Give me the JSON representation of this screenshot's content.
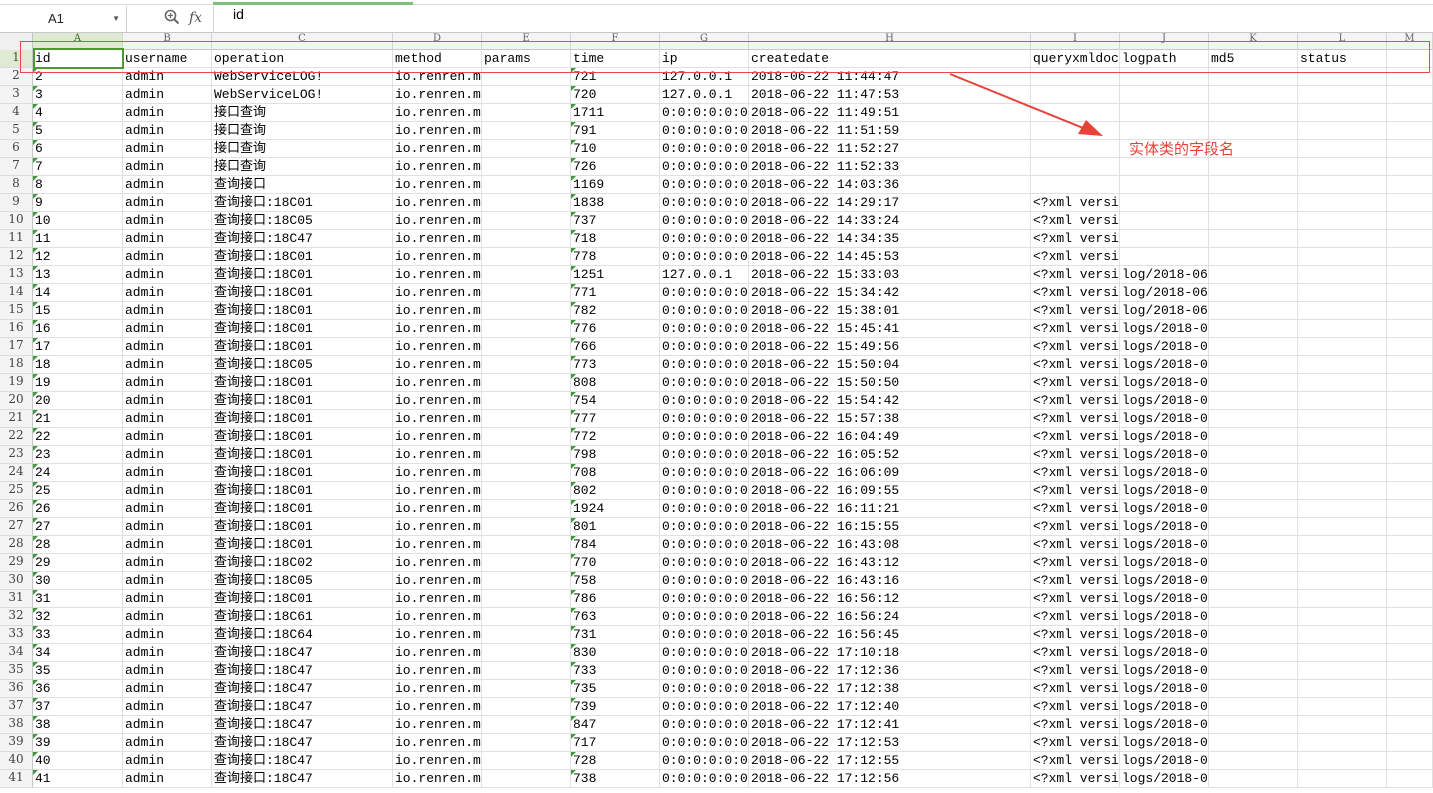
{
  "formula_bar": {
    "name_box": "A1",
    "fx_label": "fx",
    "formula": "id"
  },
  "columns": [
    {
      "letter": "A"
    },
    {
      "letter": "B"
    },
    {
      "letter": "C"
    },
    {
      "letter": "D"
    },
    {
      "letter": "E"
    },
    {
      "letter": "F"
    },
    {
      "letter": "G"
    },
    {
      "letter": "H"
    },
    {
      "letter": "I"
    },
    {
      "letter": "J"
    },
    {
      "letter": "K"
    },
    {
      "letter": "L"
    },
    {
      "letter": "M"
    }
  ],
  "header_row": [
    "id",
    "username",
    "operation",
    "method",
    "params",
    "time",
    "ip",
    "createdate",
    "queryxmldoc",
    "logpath",
    "md5",
    "status"
  ],
  "rows": [
    [
      "2",
      "admin",
      "WebServiceLOG!",
      "io.renren.m",
      "",
      "721",
      "127.0.0.1",
      "2018-06-22 11:44:47",
      "",
      "",
      "",
      ""
    ],
    [
      "3",
      "admin",
      "WebServiceLOG!",
      "io.renren.m",
      "",
      "720",
      "127.0.0.1",
      "2018-06-22 11:47:53",
      "",
      "",
      "",
      ""
    ],
    [
      "4",
      "admin",
      "接口查询",
      "io.renren.m",
      "",
      "1711",
      "0:0:0:0:0:0",
      "2018-06-22 11:49:51",
      "",
      "",
      "",
      ""
    ],
    [
      "5",
      "admin",
      "接口查询",
      "io.renren.m",
      "",
      "791",
      "0:0:0:0:0:0",
      "2018-06-22 11:51:59",
      "",
      "",
      "",
      ""
    ],
    [
      "6",
      "admin",
      "接口查询",
      "io.renren.m",
      "",
      "710",
      "0:0:0:0:0:0",
      "2018-06-22 11:52:27",
      "",
      "",
      "",
      ""
    ],
    [
      "7",
      "admin",
      "接口查询",
      "io.renren.m",
      "",
      "726",
      "0:0:0:0:0:0",
      "2018-06-22 11:52:33",
      "",
      "",
      "",
      ""
    ],
    [
      "8",
      "admin",
      "查询接口",
      "io.renren.m",
      "",
      "1169",
      "0:0:0:0:0:0",
      "2018-06-22 14:03:36",
      "",
      "",
      "",
      ""
    ],
    [
      "9",
      "admin",
      "查询接口:18C01",
      "io.renren.m",
      "",
      "1838",
      "0:0:0:0:0:0",
      "2018-06-22 14:29:17",
      "<?xml versi",
      "",
      "",
      ""
    ],
    [
      "10",
      "admin",
      "查询接口:18C05",
      "io.renren.m",
      "",
      "737",
      "0:0:0:0:0:0",
      "2018-06-22 14:33:24",
      "<?xml versi",
      "",
      "",
      ""
    ],
    [
      "11",
      "admin",
      "查询接口:18C47",
      "io.renren.m",
      "",
      "718",
      "0:0:0:0:0:0",
      "2018-06-22 14:34:35",
      "<?xml versi",
      "",
      "",
      ""
    ],
    [
      "12",
      "admin",
      "查询接口:18C01",
      "io.renren.m",
      "",
      "778",
      "0:0:0:0:0:0",
      "2018-06-22 14:45:53",
      "<?xml versi",
      "",
      "",
      ""
    ],
    [
      "13",
      "admin",
      "查询接口:18C01",
      "io.renren.m",
      "",
      "1251",
      "127.0.0.1",
      "2018-06-22 15:33:03",
      "<?xml versi",
      "log/2018-06",
      "",
      ""
    ],
    [
      "14",
      "admin",
      "查询接口:18C01",
      "io.renren.m",
      "",
      "771",
      "0:0:0:0:0:0",
      "2018-06-22 15:34:42",
      "<?xml versi",
      "log/2018-06",
      "",
      ""
    ],
    [
      "15",
      "admin",
      "查询接口:18C01",
      "io.renren.m",
      "",
      "782",
      "0:0:0:0:0:0",
      "2018-06-22 15:38:01",
      "<?xml versi",
      "log/2018-06",
      "",
      ""
    ],
    [
      "16",
      "admin",
      "查询接口:18C01",
      "io.renren.m",
      "",
      "776",
      "0:0:0:0:0:0",
      "2018-06-22 15:45:41",
      "<?xml versi",
      "logs/2018-0",
      "",
      ""
    ],
    [
      "17",
      "admin",
      "查询接口:18C01",
      "io.renren.m",
      "",
      "766",
      "0:0:0:0:0:0",
      "2018-06-22 15:49:56",
      "<?xml versi",
      "logs/2018-0",
      "",
      ""
    ],
    [
      "18",
      "admin",
      "查询接口:18C05",
      "io.renren.m",
      "",
      "773",
      "0:0:0:0:0:0",
      "2018-06-22 15:50:04",
      "<?xml versi",
      "logs/2018-0",
      "",
      ""
    ],
    [
      "19",
      "admin",
      "查询接口:18C01",
      "io.renren.m",
      "",
      "808",
      "0:0:0:0:0:0",
      "2018-06-22 15:50:50",
      "<?xml versi",
      "logs/2018-0",
      "",
      ""
    ],
    [
      "20",
      "admin",
      "查询接口:18C01",
      "io.renren.m",
      "",
      "754",
      "0:0:0:0:0:0",
      "2018-06-22 15:54:42",
      "<?xml versi",
      "logs/2018-0",
      "",
      ""
    ],
    [
      "21",
      "admin",
      "查询接口:18C01",
      "io.renren.m",
      "",
      "777",
      "0:0:0:0:0:0",
      "2018-06-22 15:57:38",
      "<?xml versi",
      "logs/2018-0",
      "",
      ""
    ],
    [
      "22",
      "admin",
      "查询接口:18C01",
      "io.renren.m",
      "",
      "772",
      "0:0:0:0:0:0",
      "2018-06-22 16:04:49",
      "<?xml versi",
      "logs/2018-0",
      "",
      ""
    ],
    [
      "23",
      "admin",
      "查询接口:18C01",
      "io.renren.m",
      "",
      "798",
      "0:0:0:0:0:0",
      "2018-06-22 16:05:52",
      "<?xml versi",
      "logs/2018-0",
      "",
      ""
    ],
    [
      "24",
      "admin",
      "查询接口:18C01",
      "io.renren.m",
      "",
      "708",
      "0:0:0:0:0:0",
      "2018-06-22 16:06:09",
      "<?xml versi",
      "logs/2018-0",
      "",
      ""
    ],
    [
      "25",
      "admin",
      "查询接口:18C01",
      "io.renren.m",
      "",
      "802",
      "0:0:0:0:0:0",
      "2018-06-22 16:09:55",
      "<?xml versi",
      "logs/2018-0",
      "",
      ""
    ],
    [
      "26",
      "admin",
      "查询接口:18C01",
      "io.renren.m",
      "",
      "1924",
      "0:0:0:0:0:0",
      "2018-06-22 16:11:21",
      "<?xml versi",
      "logs/2018-0",
      "",
      ""
    ],
    [
      "27",
      "admin",
      "查询接口:18C01",
      "io.renren.m",
      "",
      "801",
      "0:0:0:0:0:0",
      "2018-06-22 16:15:55",
      "<?xml versi",
      "logs/2018-0",
      "",
      ""
    ],
    [
      "28",
      "admin",
      "查询接口:18C01",
      "io.renren.m",
      "",
      "784",
      "0:0:0:0:0:0",
      "2018-06-22 16:43:08",
      "<?xml versi",
      "logs/2018-0",
      "",
      ""
    ],
    [
      "29",
      "admin",
      "查询接口:18C02",
      "io.renren.m",
      "",
      "770",
      "0:0:0:0:0:0",
      "2018-06-22 16:43:12",
      "<?xml versi",
      "logs/2018-0",
      "",
      ""
    ],
    [
      "30",
      "admin",
      "查询接口:18C05",
      "io.renren.m",
      "",
      "758",
      "0:0:0:0:0:0",
      "2018-06-22 16:43:16",
      "<?xml versi",
      "logs/2018-0",
      "",
      ""
    ],
    [
      "31",
      "admin",
      "查询接口:18C01",
      "io.renren.m",
      "",
      "786",
      "0:0:0:0:0:0",
      "2018-06-22 16:56:12",
      "<?xml versi",
      "logs/2018-0",
      "",
      ""
    ],
    [
      "32",
      "admin",
      "查询接口:18C61",
      "io.renren.m",
      "",
      "763",
      "0:0:0:0:0:0",
      "2018-06-22 16:56:24",
      "<?xml versi",
      "logs/2018-0",
      "",
      ""
    ],
    [
      "33",
      "admin",
      "查询接口:18C64",
      "io.renren.m",
      "",
      "731",
      "0:0:0:0:0:0",
      "2018-06-22 16:56:45",
      "<?xml versi",
      "logs/2018-0",
      "",
      ""
    ],
    [
      "34",
      "admin",
      "查询接口:18C47",
      "io.renren.m",
      "",
      "830",
      "0:0:0:0:0:0",
      "2018-06-22 17:10:18",
      "<?xml versi",
      "logs/2018-0",
      "",
      ""
    ],
    [
      "35",
      "admin",
      "查询接口:18C47",
      "io.renren.m",
      "",
      "733",
      "0:0:0:0:0:0",
      "2018-06-22 17:12:36",
      "<?xml versi",
      "logs/2018-0",
      "",
      ""
    ],
    [
      "36",
      "admin",
      "查询接口:18C47",
      "io.renren.m",
      "",
      "735",
      "0:0:0:0:0:0",
      "2018-06-22 17:12:38",
      "<?xml versi",
      "logs/2018-0",
      "",
      ""
    ],
    [
      "37",
      "admin",
      "查询接口:18C47",
      "io.renren.m",
      "",
      "739",
      "0:0:0:0:0:0",
      "2018-06-22 17:12:40",
      "<?xml versi",
      "logs/2018-0",
      "",
      ""
    ],
    [
      "38",
      "admin",
      "查询接口:18C47",
      "io.renren.m",
      "",
      "847",
      "0:0:0:0:0:0",
      "2018-06-22 17:12:41",
      "<?xml versi",
      "logs/2018-0",
      "",
      ""
    ],
    [
      "39",
      "admin",
      "查询接口:18C47",
      "io.renren.m",
      "",
      "717",
      "0:0:0:0:0:0",
      "2018-06-22 17:12:53",
      "<?xml versi",
      "logs/2018-0",
      "",
      ""
    ],
    [
      "40",
      "admin",
      "查询接口:18C47",
      "io.renren.m",
      "",
      "728",
      "0:0:0:0:0:0",
      "2018-06-22 17:12:55",
      "<?xml versi",
      "logs/2018-0",
      "",
      ""
    ],
    [
      "41",
      "admin",
      "查询接口:18C47",
      "io.renren.m",
      "",
      "738",
      "0:0:0:0:0:0",
      "2018-06-22 17:12:56",
      "<?xml versi",
      "logs/2018-0",
      "",
      ""
    ]
  ],
  "annotation": {
    "text": "实体类的字段名",
    "color": "#e8413a"
  },
  "colors": {
    "selection": "#4e9a2e",
    "highlight_box": "#e84a4a",
    "cell_marker": "#3d9a3d"
  }
}
